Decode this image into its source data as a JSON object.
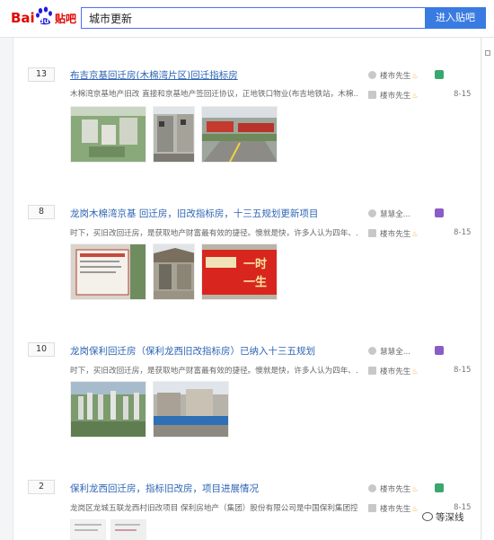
{
  "header": {
    "logo_bai": "Bai",
    "logo_du": "du",
    "logo_tieba": "贴吧",
    "search_value": "城市更新",
    "search_button": "进入贴吧"
  },
  "threads": [
    {
      "reply_count": "13",
      "title": "布吉京基回迁房(木棉湾片区)回迁指标房",
      "desc": "木棉湾京基地产旧改 直接和京基地产签回迁协议，正地铁口物业(布吉地铁站，木棉...",
      "author": "楼市先生",
      "last_replier": "楼市先生",
      "date": "8-15",
      "badge_color": "#3aa76d"
    },
    {
      "reply_count": "8",
      "title": "龙岗木棉湾京基 回迁房，旧改指标房，十三五规划更新项目",
      "desc": "时下，买旧改回迁房，是获取地产财富最有效的捷径。懊就是快，许多人认为四年、...",
      "author": "慧慧全...",
      "last_replier": "楼市先生",
      "date": "8-15",
      "badge_color": "#8a5cc8"
    },
    {
      "reply_count": "10",
      "title": "龙岗保利回迁房（保利龙西旧改指标房）已纳入十三五规划",
      "desc": "时下，买旧改回迁房，是获取地产财富最有效的捷径。懊就是快，许多人认为四年、...",
      "author": "慧慧全...",
      "last_replier": "楼市先生",
      "date": "8-15",
      "badge_color": "#8a5cc8"
    },
    {
      "reply_count": "2",
      "title": "保利龙西回迁房，指标旧改房，项目进展情况",
      "desc": "龙岗区龙城五联龙西村旧改项目 保利房地产（集团）股份有限公司是中国保利集团控...",
      "author": "楼市先生",
      "last_replier": "楼市先生",
      "date": "8-15",
      "badge_color": "#3aa76d"
    }
  ],
  "banner_texts": {
    "t2_img3_line1": "一时",
    "t2_img3_line2": "一生"
  },
  "watermark": "等深线",
  "colors": {
    "link": "#2d64b3",
    "button": "#3a7be2",
    "flame": "#f5a623"
  }
}
